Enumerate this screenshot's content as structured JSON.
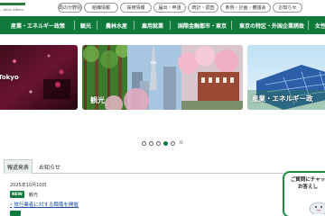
{
  "header": {
    "subtitle": "...ation Affairs",
    "utility_nav": [
      {
        "label": "局の分野別"
      },
      {
        "label": "組織情報"
      },
      {
        "label": "採用情報"
      },
      {
        "label": "届出・申請"
      },
      {
        "label": "統計・調査"
      },
      {
        "label": "条例・計画・審議会"
      },
      {
        "label": "お知らせ"
      }
    ]
  },
  "main_nav": {
    "items": [
      {
        "label": "産業・エネルギー政策"
      },
      {
        "label": "観光"
      },
      {
        "label": "農林水産"
      },
      {
        "label": "雇用就業"
      },
      {
        "label": "国際金融都市・東京"
      },
      {
        "label": "東京の特区・外国企業誘致"
      },
      {
        "label": "女性"
      }
    ],
    "color": "#0f7a3c"
  },
  "slider": {
    "slides": [
      {
        "label": "Tokyo"
      },
      {
        "label": "観光"
      },
      {
        "label": "産業・エネルギー政"
      }
    ],
    "dot_count": 5,
    "active_dot": 4,
    "pause_symbol": "II"
  },
  "tabs": [
    {
      "label": "報道発表",
      "active": true
    },
    {
      "label": "お知らせ",
      "active": false
    }
  ],
  "news": {
    "date": "2025年10月10日",
    "badge": "NEW",
    "category": "観光",
    "link_text": "旅行業者に対する職階を開催",
    "link_icon": "chevron-right-icon"
  },
  "chat": {
    "line1": "ご質問にチャッ",
    "line2": "お答えし"
  }
}
